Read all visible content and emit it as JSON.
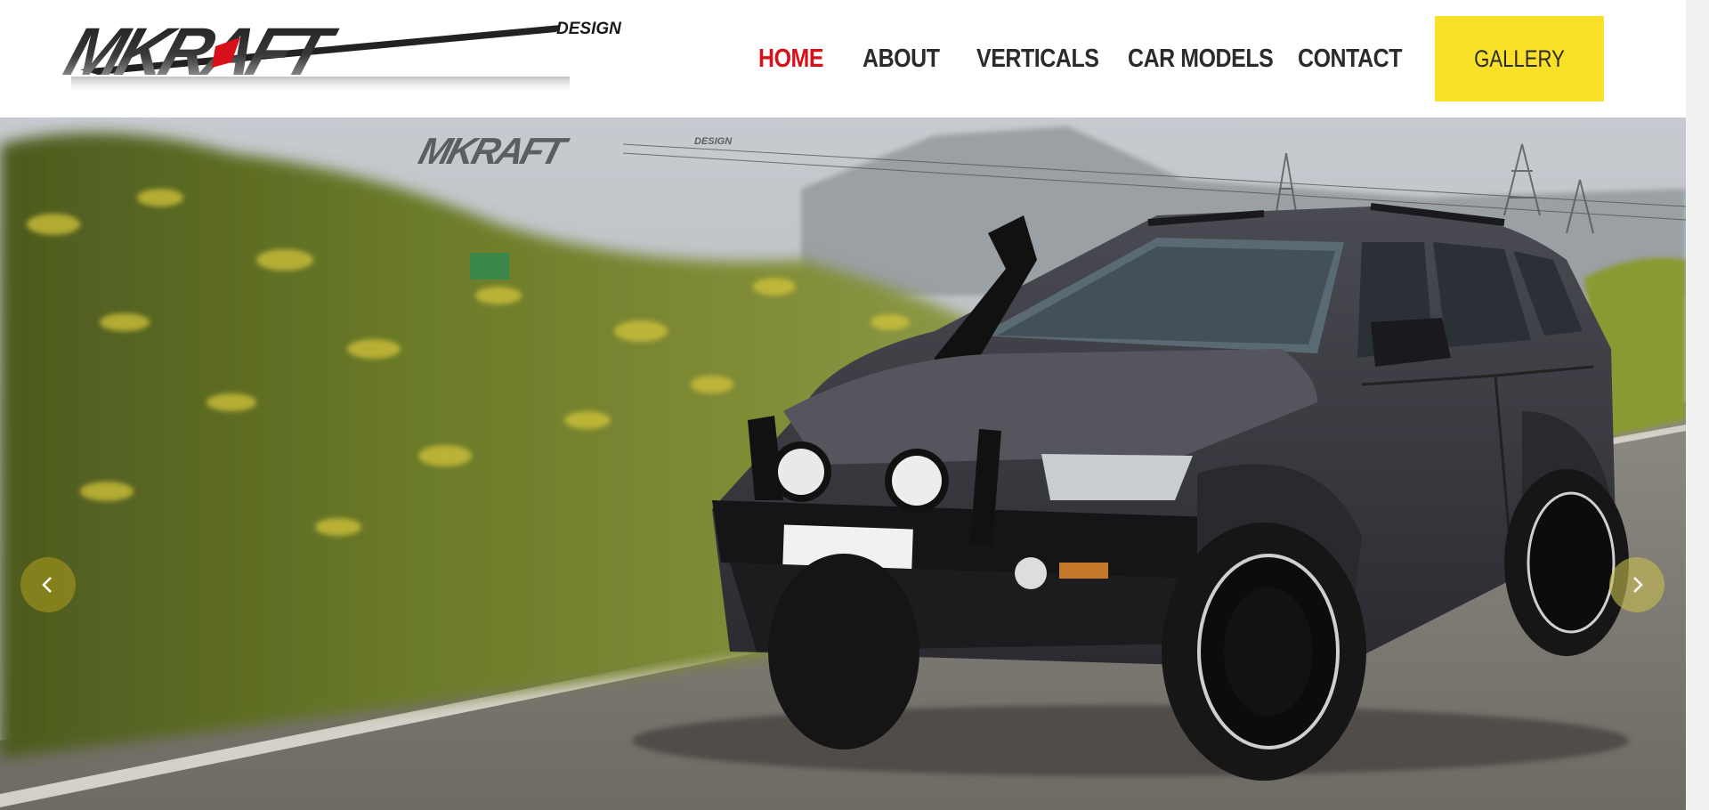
{
  "brand": {
    "logo_text": "MKRAFT",
    "logo_sub": "DESIGN"
  },
  "nav": {
    "items": [
      {
        "label": "HOME",
        "active": true
      },
      {
        "label": "ABOUT",
        "active": false
      },
      {
        "label": "VERTICALS",
        "active": false
      },
      {
        "label": "CAR MODELS",
        "active": false
      },
      {
        "label": "CONTACT",
        "active": false
      }
    ],
    "gallery_label": "GALLERY"
  },
  "hero": {
    "watermark_text": "MKRAFT",
    "watermark_sub": "DESIGN",
    "prev_icon": "chevron-left-icon",
    "next_icon": "chevron-right-icon"
  },
  "colors": {
    "accent_red": "#d8101a",
    "gallery_yellow": "#f9e12a",
    "nav_text": "#2b2b2b"
  }
}
